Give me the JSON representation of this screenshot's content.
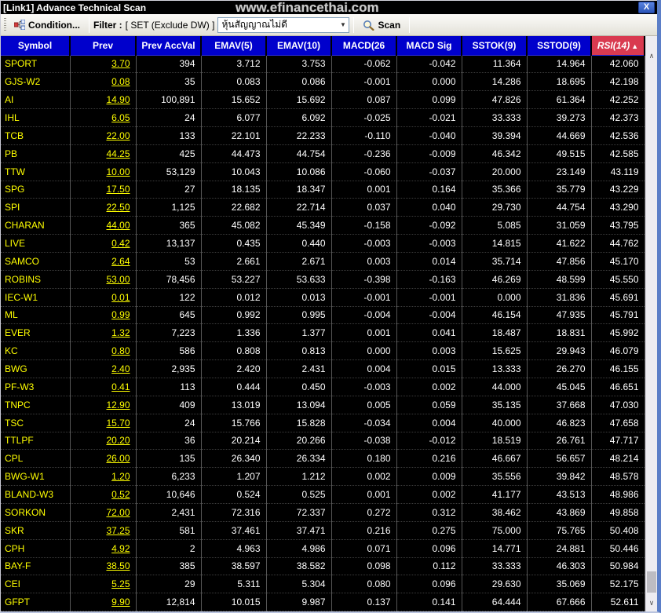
{
  "window": {
    "title": "[Link1] Advance Technical Scan",
    "watermark": "www.efinancethai.com",
    "close_label": "X"
  },
  "toolbar": {
    "condition_label": "Condition...",
    "filter_label": "Filter :",
    "filter_value": "[ SET (Exclude DW) ]",
    "signal_dropdown_value": "หุ้นสัญญาณไม่ดี",
    "scan_label": "Scan"
  },
  "colors": {
    "titlebar_black": "#000000",
    "close_button_blue": "#2e62c9",
    "header_blue": "#0000cc",
    "rsi_header_red": "#d93a50",
    "symbol_yellow": "#ffff00",
    "value_white": "#ffffff",
    "grid_background": "#000000"
  },
  "table": {
    "sort": {
      "column": "RSI(14)",
      "direction": "asc"
    },
    "columns": [
      {
        "key": "symbol",
        "label": "Symbol"
      },
      {
        "key": "prev",
        "label": "Prev"
      },
      {
        "key": "prev_accval",
        "label": "Prev AccVal"
      },
      {
        "key": "emav5",
        "label": "EMAV(5)"
      },
      {
        "key": "emav10",
        "label": "EMAV(10)"
      },
      {
        "key": "macd26",
        "label": "MACD(26"
      },
      {
        "key": "macd_sig",
        "label": "MACD Sig"
      },
      {
        "key": "sstok9",
        "label": "SSTOK(9)"
      },
      {
        "key": "sstod9",
        "label": "SSTOD(9)"
      },
      {
        "key": "rsi14",
        "label": "RSI(14)",
        "highlight": true,
        "sorted": "asc"
      }
    ],
    "rows": [
      [
        "SPORT",
        "3.70",
        "394",
        "3.712",
        "3.753",
        "-0.062",
        "-0.042",
        "11.364",
        "14.964",
        "42.060"
      ],
      [
        "GJS-W2",
        "0.08",
        "35",
        "0.083",
        "0.086",
        "-0.001",
        "0.000",
        "14.286",
        "18.695",
        "42.198"
      ],
      [
        "AI",
        "14.90",
        "100,891",
        "15.652",
        "15.692",
        "0.087",
        "0.099",
        "47.826",
        "61.364",
        "42.252"
      ],
      [
        "IHL",
        "6.05",
        "24",
        "6.077",
        "6.092",
        "-0.025",
        "-0.021",
        "33.333",
        "39.273",
        "42.373"
      ],
      [
        "TCB",
        "22.00",
        "133",
        "22.101",
        "22.233",
        "-0.110",
        "-0.040",
        "39.394",
        "44.669",
        "42.536"
      ],
      [
        "PB",
        "44.25",
        "425",
        "44.473",
        "44.754",
        "-0.236",
        "-0.009",
        "46.342",
        "49.515",
        "42.585"
      ],
      [
        "TTW",
        "10.00",
        "53,129",
        "10.043",
        "10.086",
        "-0.060",
        "-0.037",
        "20.000",
        "23.149",
        "43.119"
      ],
      [
        "SPG",
        "17.50",
        "27",
        "18.135",
        "18.347",
        "0.001",
        "0.164",
        "35.366",
        "35.779",
        "43.229"
      ],
      [
        "SPI",
        "22.50",
        "1,125",
        "22.682",
        "22.714",
        "0.037",
        "0.040",
        "29.730",
        "44.754",
        "43.290"
      ],
      [
        "CHARAN",
        "44.00",
        "365",
        "45.082",
        "45.349",
        "-0.158",
        "-0.092",
        "5.085",
        "31.059",
        "43.795"
      ],
      [
        "LIVE",
        "0.42",
        "13,137",
        "0.435",
        "0.440",
        "-0.003",
        "-0.003",
        "14.815",
        "41.622",
        "44.762"
      ],
      [
        "SAMCO",
        "2.64",
        "53",
        "2.661",
        "2.671",
        "0.003",
        "0.014",
        "35.714",
        "47.856",
        "45.170"
      ],
      [
        "ROBINS",
        "53.00",
        "78,456",
        "53.227",
        "53.633",
        "-0.398",
        "-0.163",
        "46.269",
        "48.599",
        "45.550"
      ],
      [
        "IEC-W1",
        "0.01",
        "122",
        "0.012",
        "0.013",
        "-0.001",
        "-0.001",
        "0.000",
        "31.836",
        "45.691"
      ],
      [
        "ML",
        "0.99",
        "645",
        "0.992",
        "0.995",
        "-0.004",
        "-0.004",
        "46.154",
        "47.935",
        "45.791"
      ],
      [
        "EVER",
        "1.32",
        "7,223",
        "1.336",
        "1.377",
        "0.001",
        "0.041",
        "18.487",
        "18.831",
        "45.992"
      ],
      [
        "KC",
        "0.80",
        "586",
        "0.808",
        "0.813",
        "0.000",
        "0.003",
        "15.625",
        "29.943",
        "46.079"
      ],
      [
        "BWG",
        "2.40",
        "2,935",
        "2.420",
        "2.431",
        "0.004",
        "0.015",
        "13.333",
        "26.270",
        "46.155"
      ],
      [
        "PF-W3",
        "0.41",
        "113",
        "0.444",
        "0.450",
        "-0.003",
        "0.002",
        "44.000",
        "45.045",
        "46.651"
      ],
      [
        "TNPC",
        "12.90",
        "409",
        "13.019",
        "13.094",
        "0.005",
        "0.059",
        "35.135",
        "37.668",
        "47.030"
      ],
      [
        "TSC",
        "15.70",
        "24",
        "15.766",
        "15.828",
        "-0.034",
        "0.004",
        "40.000",
        "46.823",
        "47.658"
      ],
      [
        "TTLPF",
        "20.20",
        "36",
        "20.214",
        "20.266",
        "-0.038",
        "-0.012",
        "18.519",
        "26.761",
        "47.717"
      ],
      [
        "CPL",
        "26.00",
        "135",
        "26.340",
        "26.334",
        "0.180",
        "0.216",
        "46.667",
        "56.657",
        "48.214"
      ],
      [
        "BWG-W1",
        "1.20",
        "6,233",
        "1.207",
        "1.212",
        "0.002",
        "0.009",
        "35.556",
        "39.842",
        "48.578"
      ],
      [
        "BLAND-W3",
        "0.52",
        "10,646",
        "0.524",
        "0.525",
        "0.001",
        "0.002",
        "41.177",
        "43.513",
        "48.986"
      ],
      [
        "SORKON",
        "72.00",
        "2,431",
        "72.316",
        "72.337",
        "0.272",
        "0.312",
        "38.462",
        "43.869",
        "49.858"
      ],
      [
        "SKR",
        "37.25",
        "581",
        "37.461",
        "37.471",
        "0.216",
        "0.275",
        "75.000",
        "75.765",
        "50.408"
      ],
      [
        "CPH",
        "4.92",
        "2",
        "4.963",
        "4.986",
        "0.071",
        "0.096",
        "14.771",
        "24.881",
        "50.446"
      ],
      [
        "BAY-F",
        "38.50",
        "385",
        "38.597",
        "38.582",
        "0.098",
        "0.112",
        "33.333",
        "46.303",
        "50.984"
      ],
      [
        "CEI",
        "5.25",
        "29",
        "5.311",
        "5.304",
        "0.080",
        "0.096",
        "29.630",
        "35.069",
        "52.175"
      ],
      [
        "GFPT",
        "9.90",
        "12,814",
        "10.015",
        "9.987",
        "0.137",
        "0.141",
        "64.444",
        "67.666",
        "52.611"
      ]
    ]
  }
}
